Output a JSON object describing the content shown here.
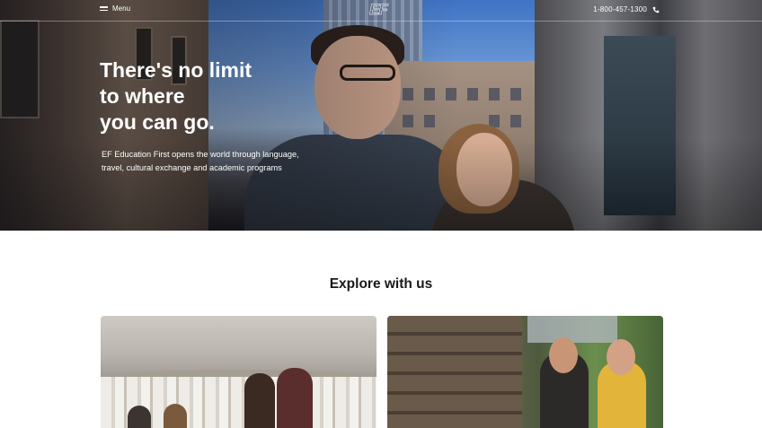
{
  "nav": {
    "menu_label": "Menu",
    "logo_text": "EF",
    "phone": "1-800-457-1300",
    "menu_icon": "hamburger-icon",
    "phone_icon": "phone-icon"
  },
  "hero": {
    "headline_lines": [
      "There's no limit",
      "to where",
      "you can go."
    ],
    "subtext": "EF Education First opens the world through language, travel, cultural exchange and academic programs"
  },
  "explore": {
    "title": "Explore with us"
  },
  "colors": {
    "text_dark": "#191919",
    "hero_text": "#ffffff",
    "page_bg": "#ffffff"
  }
}
